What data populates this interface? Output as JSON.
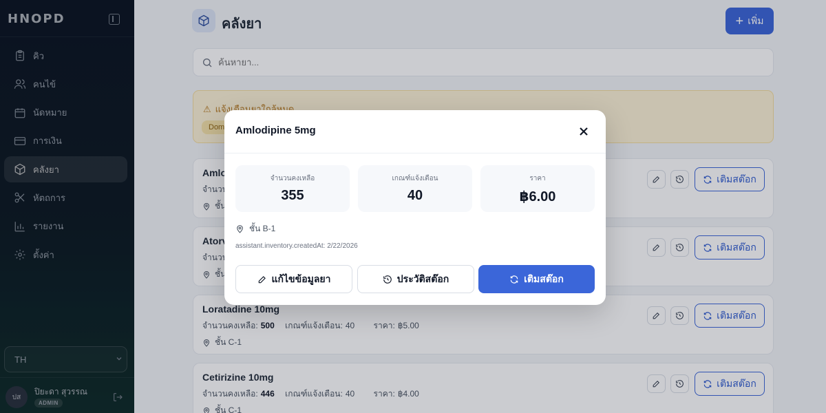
{
  "app": {
    "brand": "HNOPD"
  },
  "sidebar": {
    "items": [
      {
        "label": "คิว",
        "icon": "clipboard-icon"
      },
      {
        "label": "คนไข้",
        "icon": "users-icon"
      },
      {
        "label": "นัดหมาย",
        "icon": "calendar-icon"
      },
      {
        "label": "การเงิน",
        "icon": "credit-card-icon"
      },
      {
        "label": "คลังยา",
        "icon": "package-icon",
        "active": true
      },
      {
        "label": "หัตถการ",
        "icon": "scissors-icon"
      },
      {
        "label": "รายงาน",
        "icon": "bar-chart-icon"
      },
      {
        "label": "ตั้งค่า",
        "icon": "gear-icon"
      }
    ],
    "language": "TH",
    "user": {
      "initials": "ปส",
      "name": "ปิยะดา สุวรรณ",
      "role": "ADMIN"
    }
  },
  "header": {
    "title": "คลังยา",
    "add_label": "เพิ่ม"
  },
  "search": {
    "placeholder": "ค้นหายา..."
  },
  "alert": {
    "title": "แจ้งเตือนยาใกล้หมด",
    "chip": "Dom"
  },
  "inventory": {
    "labels": {
      "stock": "จำนวนคงเหลือ:",
      "threshold": "เกณฑ์แจ้งเตือน:",
      "price": "ราคา:",
      "refill": "เติมสต๊อก"
    },
    "items": [
      {
        "name": "Amlo",
        "stock": "",
        "threshold": "",
        "price": "",
        "location": "ชั้น"
      },
      {
        "name": "Atorv",
        "stock": "",
        "threshold": "",
        "price": "",
        "location": "ชั้น"
      },
      {
        "name": "Loratadine 10mg",
        "stock": "500",
        "threshold": "40",
        "price": "฿5.00",
        "location": "ชั้น C-1"
      },
      {
        "name": "Cetirizine 10mg",
        "stock": "446",
        "threshold": "40",
        "price": "฿4.00",
        "location": "ชั้น C-1"
      }
    ]
  },
  "modal": {
    "title": "Amlodipine 5mg",
    "stats": [
      {
        "label": "จำนวนคงเหลือ",
        "value": "355"
      },
      {
        "label": "เกณฑ์แจ้งเตือน",
        "value": "40"
      },
      {
        "label": "ราคา",
        "value": "฿6.00"
      }
    ],
    "location": "ชั้น B-1",
    "created": "assistant.inventory.createdAt: 2/22/2026",
    "buttons": {
      "edit": "แก้ไขข้อมูลยา",
      "history": "ประวัติสต๊อก",
      "refill": "เติมสต๊อก"
    }
  },
  "colors": {
    "primary": "#3b66d9",
    "sidebar": "#0f1b2d",
    "warning": "#fdf3d7"
  }
}
